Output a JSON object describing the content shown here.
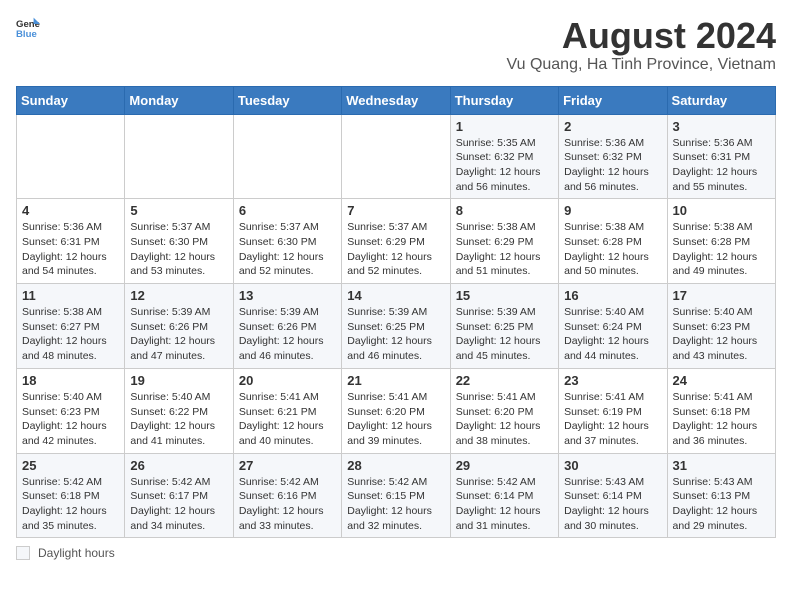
{
  "header": {
    "logo_general": "General",
    "logo_blue": "Blue",
    "month_title": "August 2024",
    "location": "Vu Quang, Ha Tinh Province, Vietnam"
  },
  "calendar": {
    "days_of_week": [
      "Sunday",
      "Monday",
      "Tuesday",
      "Wednesday",
      "Thursday",
      "Friday",
      "Saturday"
    ],
    "weeks": [
      [
        {
          "day": "",
          "info": ""
        },
        {
          "day": "",
          "info": ""
        },
        {
          "day": "",
          "info": ""
        },
        {
          "day": "",
          "info": ""
        },
        {
          "day": "1",
          "info": "Sunrise: 5:35 AM\nSunset: 6:32 PM\nDaylight: 12 hours and 56 minutes."
        },
        {
          "day": "2",
          "info": "Sunrise: 5:36 AM\nSunset: 6:32 PM\nDaylight: 12 hours and 56 minutes."
        },
        {
          "day": "3",
          "info": "Sunrise: 5:36 AM\nSunset: 6:31 PM\nDaylight: 12 hours and 55 minutes."
        }
      ],
      [
        {
          "day": "4",
          "info": "Sunrise: 5:36 AM\nSunset: 6:31 PM\nDaylight: 12 hours and 54 minutes."
        },
        {
          "day": "5",
          "info": "Sunrise: 5:37 AM\nSunset: 6:30 PM\nDaylight: 12 hours and 53 minutes."
        },
        {
          "day": "6",
          "info": "Sunrise: 5:37 AM\nSunset: 6:30 PM\nDaylight: 12 hours and 52 minutes."
        },
        {
          "day": "7",
          "info": "Sunrise: 5:37 AM\nSunset: 6:29 PM\nDaylight: 12 hours and 52 minutes."
        },
        {
          "day": "8",
          "info": "Sunrise: 5:38 AM\nSunset: 6:29 PM\nDaylight: 12 hours and 51 minutes."
        },
        {
          "day": "9",
          "info": "Sunrise: 5:38 AM\nSunset: 6:28 PM\nDaylight: 12 hours and 50 minutes."
        },
        {
          "day": "10",
          "info": "Sunrise: 5:38 AM\nSunset: 6:28 PM\nDaylight: 12 hours and 49 minutes."
        }
      ],
      [
        {
          "day": "11",
          "info": "Sunrise: 5:38 AM\nSunset: 6:27 PM\nDaylight: 12 hours and 48 minutes."
        },
        {
          "day": "12",
          "info": "Sunrise: 5:39 AM\nSunset: 6:26 PM\nDaylight: 12 hours and 47 minutes."
        },
        {
          "day": "13",
          "info": "Sunrise: 5:39 AM\nSunset: 6:26 PM\nDaylight: 12 hours and 46 minutes."
        },
        {
          "day": "14",
          "info": "Sunrise: 5:39 AM\nSunset: 6:25 PM\nDaylight: 12 hours and 46 minutes."
        },
        {
          "day": "15",
          "info": "Sunrise: 5:39 AM\nSunset: 6:25 PM\nDaylight: 12 hours and 45 minutes."
        },
        {
          "day": "16",
          "info": "Sunrise: 5:40 AM\nSunset: 6:24 PM\nDaylight: 12 hours and 44 minutes."
        },
        {
          "day": "17",
          "info": "Sunrise: 5:40 AM\nSunset: 6:23 PM\nDaylight: 12 hours and 43 minutes."
        }
      ],
      [
        {
          "day": "18",
          "info": "Sunrise: 5:40 AM\nSunset: 6:23 PM\nDaylight: 12 hours and 42 minutes."
        },
        {
          "day": "19",
          "info": "Sunrise: 5:40 AM\nSunset: 6:22 PM\nDaylight: 12 hours and 41 minutes."
        },
        {
          "day": "20",
          "info": "Sunrise: 5:41 AM\nSunset: 6:21 PM\nDaylight: 12 hours and 40 minutes."
        },
        {
          "day": "21",
          "info": "Sunrise: 5:41 AM\nSunset: 6:20 PM\nDaylight: 12 hours and 39 minutes."
        },
        {
          "day": "22",
          "info": "Sunrise: 5:41 AM\nSunset: 6:20 PM\nDaylight: 12 hours and 38 minutes."
        },
        {
          "day": "23",
          "info": "Sunrise: 5:41 AM\nSunset: 6:19 PM\nDaylight: 12 hours and 37 minutes."
        },
        {
          "day": "24",
          "info": "Sunrise: 5:41 AM\nSunset: 6:18 PM\nDaylight: 12 hours and 36 minutes."
        }
      ],
      [
        {
          "day": "25",
          "info": "Sunrise: 5:42 AM\nSunset: 6:18 PM\nDaylight: 12 hours and 35 minutes."
        },
        {
          "day": "26",
          "info": "Sunrise: 5:42 AM\nSunset: 6:17 PM\nDaylight: 12 hours and 34 minutes."
        },
        {
          "day": "27",
          "info": "Sunrise: 5:42 AM\nSunset: 6:16 PM\nDaylight: 12 hours and 33 minutes."
        },
        {
          "day": "28",
          "info": "Sunrise: 5:42 AM\nSunset: 6:15 PM\nDaylight: 12 hours and 32 minutes."
        },
        {
          "day": "29",
          "info": "Sunrise: 5:42 AM\nSunset: 6:14 PM\nDaylight: 12 hours and 31 minutes."
        },
        {
          "day": "30",
          "info": "Sunrise: 5:43 AM\nSunset: 6:14 PM\nDaylight: 12 hours and 30 minutes."
        },
        {
          "day": "31",
          "info": "Sunrise: 5:43 AM\nSunset: 6:13 PM\nDaylight: 12 hours and 29 minutes."
        }
      ]
    ]
  },
  "footer": {
    "daylight_label": "Daylight hours"
  }
}
